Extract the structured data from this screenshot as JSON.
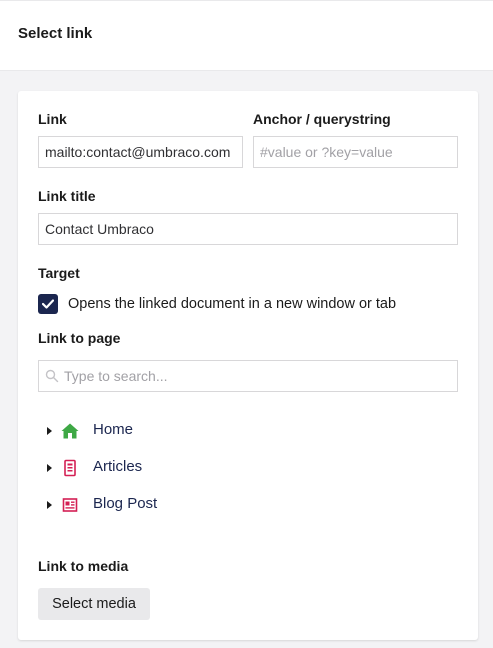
{
  "header": {
    "title": "Select link"
  },
  "form": {
    "link": {
      "label": "Link",
      "value": "mailto:contact@umbraco.com"
    },
    "anchor": {
      "label": "Anchor / querystring",
      "placeholder": "#value or ?key=value"
    },
    "link_title": {
      "label": "Link title",
      "value": "Contact Umbraco"
    },
    "target": {
      "label": "Target",
      "checkbox_label": "Opens the linked document in a new window or tab",
      "checked": true
    },
    "link_to_page": {
      "label": "Link to page",
      "search_placeholder": "Type to search..."
    },
    "tree": [
      {
        "name": "Home",
        "icon": "home-icon",
        "color": "#3ea845"
      },
      {
        "name": "Articles",
        "icon": "articles-icon",
        "color": "#d42054"
      },
      {
        "name": "Blog Post",
        "icon": "blog-post-icon",
        "color": "#d42054"
      }
    ],
    "link_to_media": {
      "label": "Link to media",
      "button": "Select media"
    }
  }
}
